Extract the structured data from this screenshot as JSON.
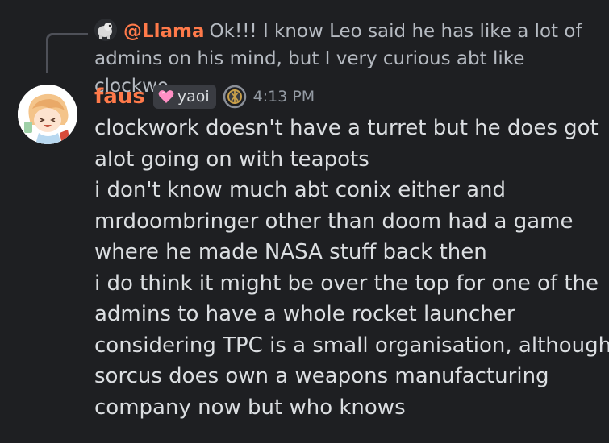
{
  "reply": {
    "author": "@Llama",
    "text": "Ok!!!  I know Leo said he has like a lot of admins on his mind, but I very curious abt like clockwo..."
  },
  "message": {
    "author": "faus",
    "tag": "yaoi",
    "timestamp": "4:13 PM",
    "lines": [
      "clockwork doesn't have a turret but he does got",
      "alot going on with teapots",
      "i don't know much abt conix either and",
      "mrdoombringer other than doom had a game",
      "where he made NASA stuff back then",
      "i do think it might be over the top for one of the",
      "admins to have a whole rocket launcher",
      "considering TPC is a small organisation, although",
      "sorcus does own a weapons manufacturing",
      "company now but who knows"
    ]
  },
  "icons": {
    "reply_avatar": "llama-avatar-icon",
    "avatar": "user-avatar-icon",
    "tag": "pink-heart-icon",
    "badge": "server-badge-icon"
  },
  "colors": {
    "background": "#1e1f22",
    "author": "#ff7a4a",
    "text": "#dbdee1",
    "muted": "#b5bac1",
    "timestamp": "#949ba4",
    "tag_heart": "#ff8fc4"
  }
}
